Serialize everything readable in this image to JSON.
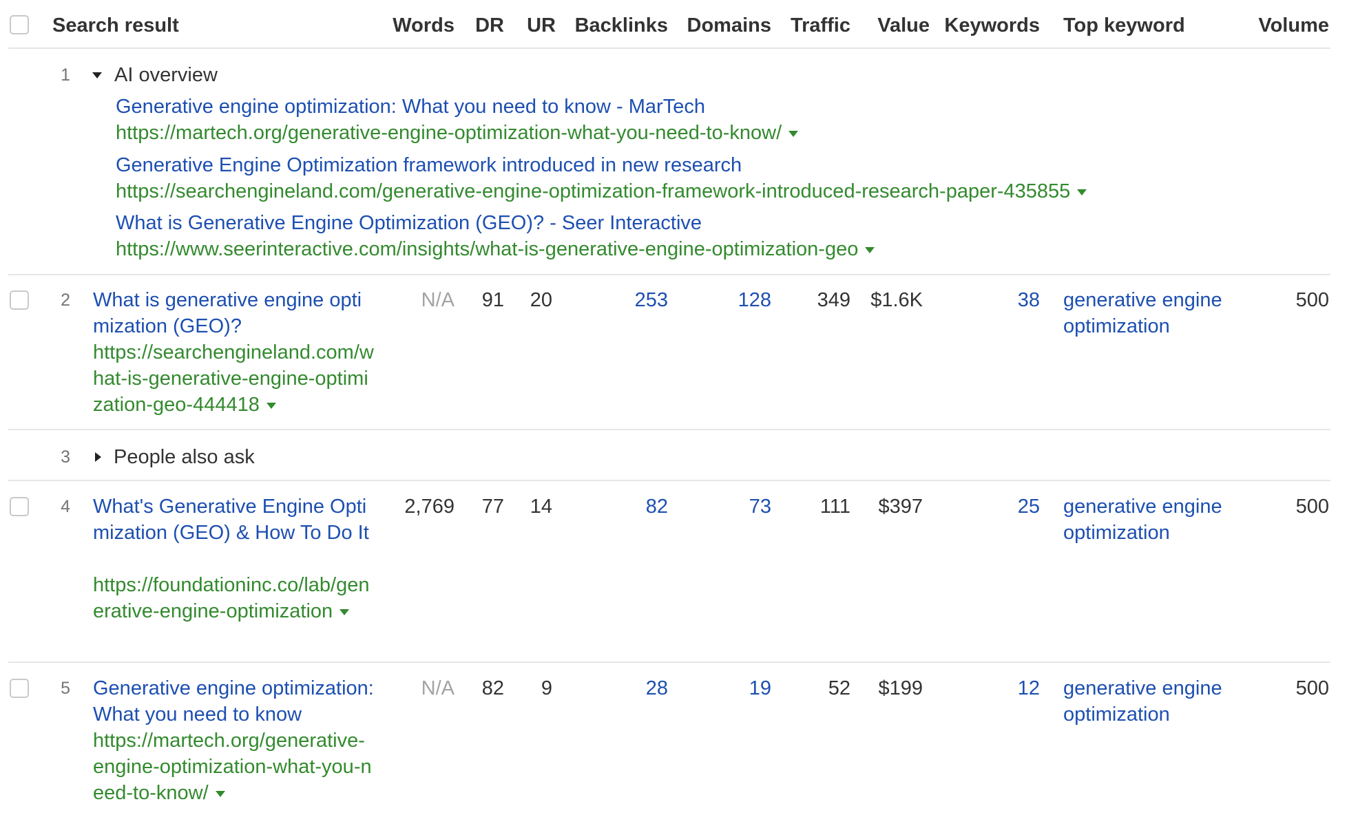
{
  "columns": {
    "search_result": "Search result",
    "words": "Words",
    "dr": "DR",
    "ur": "UR",
    "backlinks": "Backlinks",
    "domains": "Domains",
    "traffic": "Traffic",
    "value": "Value",
    "keywords": "Keywords",
    "top_keyword": "Top keyword",
    "volume": "Volume"
  },
  "ai_overview": {
    "num": "1",
    "label": "AI overview",
    "links": [
      {
        "title": "Generative engine optimization: What you need to know - MarTech",
        "url": "https://martech.org/generative-engine-optimization-what-you-need-to-know/"
      },
      {
        "title": "Generative Engine Optimization framework introduced in new research",
        "url": "https://searchengineland.com/generative-engine-optimization-framework-introduced-research-paper-435855"
      },
      {
        "title": "What is Generative Engine Optimization (GEO)? - Seer Interactive",
        "url": "https://www.seerinteractive.com/insights/what-is-generative-engine-optimization-geo"
      }
    ]
  },
  "people_also_ask": {
    "num": "3",
    "label": "People also ask"
  },
  "rows": [
    {
      "num": "2",
      "title": "What is generative engine optimization (GEO)?",
      "url": "https://searchengineland.com/what-is-generative-engine-optimization-geo-444418",
      "words": "N/A",
      "dr": "91",
      "ur": "20",
      "backlinks": "253",
      "domains": "128",
      "traffic": "349",
      "value": "$1.6K",
      "keywords": "38",
      "top_keyword": "generative engine optimization",
      "volume": "500"
    },
    {
      "num": "4",
      "title": "What's Generative Engine Optimization (GEO) & How To Do It",
      "url": "https://foundationinc.co/lab/generative-engine-optimization",
      "words": "2,769",
      "dr": "77",
      "ur": "14",
      "backlinks": "82",
      "domains": "73",
      "traffic": "111",
      "value": "$397",
      "keywords": "25",
      "top_keyword": "generative engine optimization",
      "volume": "500"
    },
    {
      "num": "5",
      "title": "Generative engine optimization: What you need to know",
      "url": "https://martech.org/generative-engine-optimization-what-you-need-to-know/",
      "words": "N/A",
      "dr": "82",
      "ur": "9",
      "backlinks": "28",
      "domains": "19",
      "traffic": "52",
      "value": "$199",
      "keywords": "12",
      "top_keyword": "generative engine optimization",
      "volume": "500"
    }
  ],
  "colors": {
    "link": "#1d4fb1",
    "url": "#338a2e",
    "text": "#333333",
    "muted": "#a3a3a3"
  }
}
